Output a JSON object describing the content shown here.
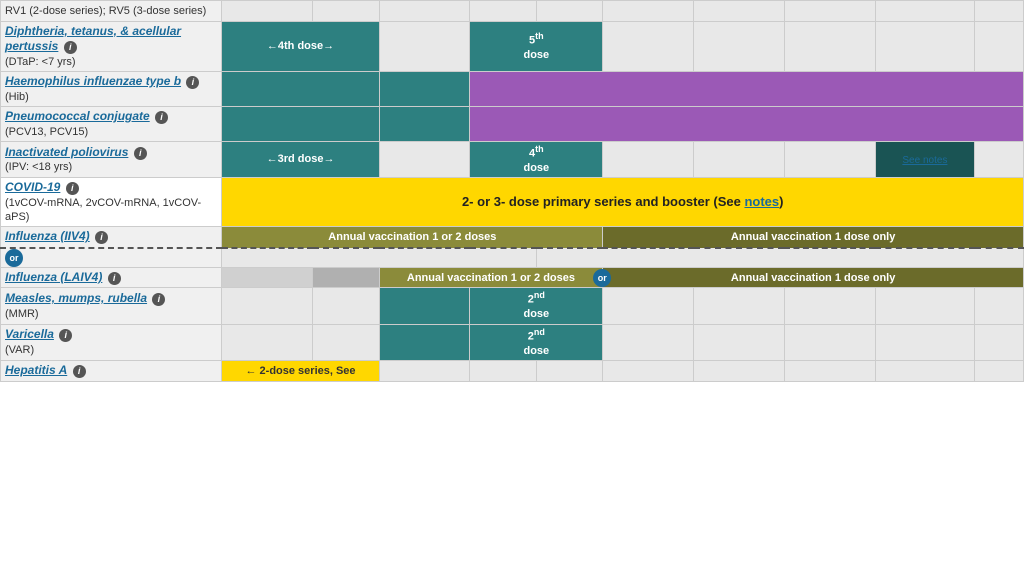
{
  "rows": [
    {
      "id": "rv",
      "name": "",
      "sub": "RV1 (2-dose series); RV5 (3-dose series)",
      "nameIsLink": false,
      "cells": [
        {
          "span": 1,
          "color": "empty",
          "text": ""
        },
        {
          "span": 1,
          "color": "empty",
          "text": ""
        },
        {
          "span": 1,
          "color": "empty",
          "text": ""
        },
        {
          "span": 1,
          "color": "empty",
          "text": ""
        },
        {
          "span": 1,
          "color": "empty",
          "text": ""
        },
        {
          "span": 1,
          "color": "empty",
          "text": ""
        },
        {
          "span": 1,
          "color": "empty",
          "text": ""
        },
        {
          "span": 1,
          "color": "empty",
          "text": ""
        },
        {
          "span": 1,
          "color": "empty",
          "text": ""
        },
        {
          "span": 1,
          "color": "empty",
          "text": ""
        }
      ]
    }
  ],
  "vaccines": [
    {
      "id": "dtap",
      "name": "Diphtheria, tetanus, & acellular pertussis",
      "sub": "(DTaP: <7 yrs)",
      "hasInfo": true,
      "nameIsLink": true
    },
    {
      "id": "hib",
      "name": "Haemophilus influenzae type b",
      "sub": "(Hib)",
      "hasInfo": true,
      "nameIsLink": true
    },
    {
      "id": "pcv",
      "name": "Pneumococcal conjugate",
      "sub": "(PCV13, PCV15)",
      "hasInfo": true,
      "nameIsLink": true
    },
    {
      "id": "ipv",
      "name": "Inactivated poliovirus",
      "sub": "(IPV: <18 yrs)",
      "hasInfo": true,
      "nameIsLink": true
    },
    {
      "id": "covid",
      "name": "COVID-19",
      "sub": "(1vCOV-mRNA, 2vCOV-mRNA, 1vCOV-aPS)",
      "hasInfo": true,
      "nameIsLink": true
    },
    {
      "id": "flu-iiv4",
      "name": "Influenza (IIV4)",
      "sub": "",
      "hasInfo": true,
      "nameIsLink": true
    },
    {
      "id": "flu-laiv4",
      "name": "Influenza (LAIV4)",
      "sub": "",
      "hasInfo": true,
      "nameIsLink": true
    },
    {
      "id": "mmr",
      "name": "Measles, mumps, rubella",
      "sub": "(MMR)",
      "hasInfo": true,
      "nameIsLink": true
    },
    {
      "id": "var",
      "name": "Varicella",
      "sub": "(VAR)",
      "hasInfo": true,
      "nameIsLink": true
    },
    {
      "id": "hepa",
      "name": "Hepatitis A",
      "sub": "",
      "hasInfo": true,
      "nameIsLink": true
    }
  ],
  "header": {
    "rv_text": "RV1 (2-dose series); RV5 (3-dose series)"
  },
  "labels": {
    "fourth_dose_arrow": "←4th dose→",
    "fifth_dose": "5th dose",
    "third_dose_arrow": "←3rd dose→",
    "fourth_dose": "4th dose",
    "second_dose": "2nd dose",
    "see_notes": "See notes",
    "covid_label": "2- or 3- dose primary series and booster (See notes)",
    "flu_annual_1or2": "Annual vaccination 1 or 2 doses",
    "flu_annual_1only": "Annual vaccination 1 dose only",
    "flu_annual_1or2_b": "Annual vaccination 1 or 2 doses",
    "flu_annual_1only_b": "Annual vaccination 1 dose only",
    "two_dose_series": "← 2-dose series, See",
    "or_label": "or"
  }
}
